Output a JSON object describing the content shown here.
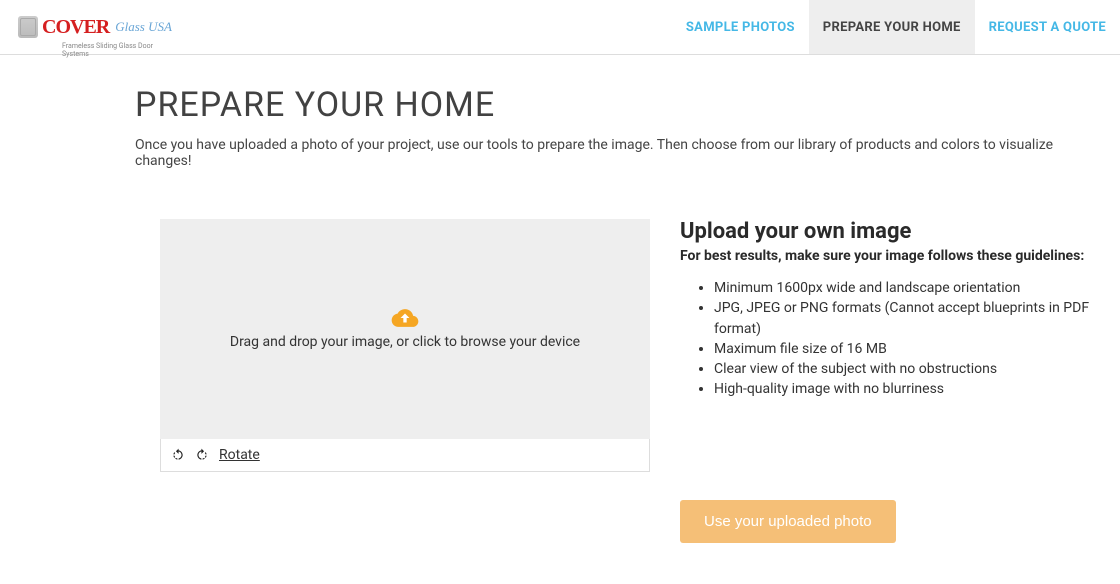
{
  "logo": {
    "main": "COVER",
    "sub": "Glass USA",
    "tagline": "Frameless Sliding Glass Door Systems"
  },
  "nav": {
    "samples": "SAMPLE PHOTOS",
    "prepare": "PREPARE YOUR HOME",
    "quote": "REQUEST A QUOTE"
  },
  "page": {
    "title": "PREPARE YOUR HOME",
    "subtitle": "Once you have uploaded a photo of your project, use our tools to prepare the image. Then choose from our library of products and colors to visualize changes!"
  },
  "dropzone": {
    "text": "Drag and drop your image, or click to browse your device"
  },
  "rotate": {
    "label": "Rotate"
  },
  "upload_info": {
    "title": "Upload your own image",
    "subtitle": "For best results, make sure your image follows these guidelines:",
    "guidelines": [
      "Minimum 1600px wide and landscape orientation",
      "JPG, JPEG or PNG formats (Cannot accept blueprints in PDF format)",
      "Maximum file size of 16 MB",
      "Clear view of the subject with no obstructions",
      "High-quality image with no blurriness"
    ]
  },
  "cta": {
    "label": "Use your uploaded photo"
  }
}
